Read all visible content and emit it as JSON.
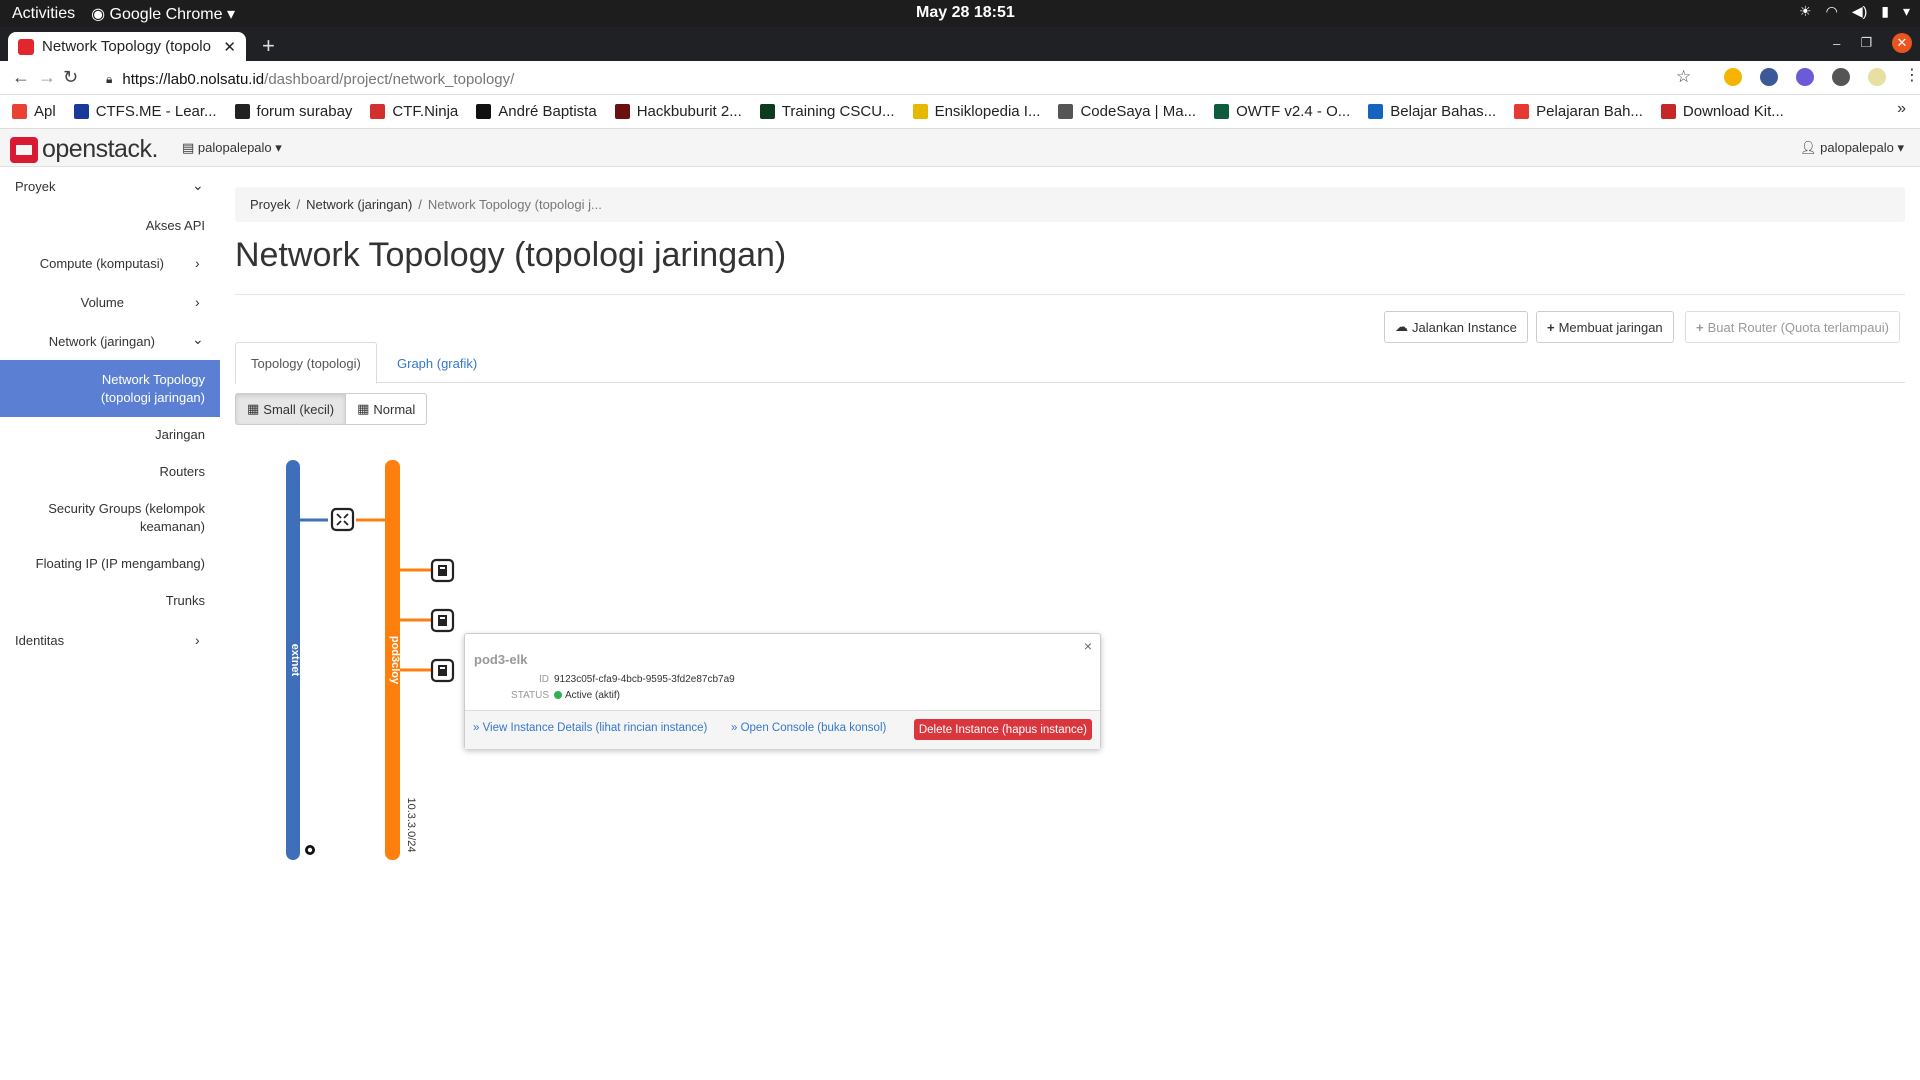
{
  "os": {
    "activities": "Activities",
    "app": "Google Chrome",
    "datetime": "May 28  18:51"
  },
  "browser": {
    "tab_title": "Network Topology (topolo",
    "url_host": "https://lab0.nolsatu.id",
    "url_path": "/dashboard/project/network_topology/",
    "bookmarks": [
      {
        "label": "Apl",
        "color": "#e94235"
      },
      {
        "label": "CTFS.ME - Lear...",
        "color": "#1a3a9a"
      },
      {
        "label": "forum surabay",
        "color": "#222222"
      },
      {
        "label": "CTF.Ninja",
        "color": "#d32f2f"
      },
      {
        "label": "André Baptista",
        "color": "#111111"
      },
      {
        "label": "Hackbuburit 2...",
        "color": "#6b0f0f"
      },
      {
        "label": "Training CSCU...",
        "color": "#0d3b1e"
      },
      {
        "label": "Ensiklopedia I...",
        "color": "#e6b800"
      },
      {
        "label": "CodeSaya | Ma...",
        "color": "#555555"
      },
      {
        "label": "OWTF v2.4 - O...",
        "color": "#0b5d3b"
      },
      {
        "label": "Belajar Bahas...",
        "color": "#1565c0"
      },
      {
        "label": "Pelajaran Bah...",
        "color": "#e53935"
      },
      {
        "label": "Download Kit...",
        "color": "#c62828"
      }
    ]
  },
  "header": {
    "logo": "openstack.",
    "project": "palopalepalo",
    "user": "palopalepalo"
  },
  "sidebar": {
    "items": [
      {
        "label": "Proyek"
      },
      {
        "label": "Akses API"
      },
      {
        "label": "Compute (komputasi)"
      },
      {
        "label": "Volume"
      },
      {
        "label": "Network (jaringan)"
      },
      {
        "label": "Network Topology (topologi jaringan)"
      },
      {
        "label": "Jaringan"
      },
      {
        "label": "Routers"
      },
      {
        "label": "Security Groups (kelompok keamanan)"
      },
      {
        "label": "Floating IP (IP mengambang)"
      },
      {
        "label": "Trunks"
      },
      {
        "label": "Identitas"
      }
    ]
  },
  "breadcrumb": {
    "items": [
      "Proyek",
      "Network (jaringan)",
      "Network Topology (topologi j..."
    ]
  },
  "page": {
    "title": "Network Topology (topologi jaringan)"
  },
  "actions": {
    "launch": "Jalankan Instance",
    "create_network": "Membuat jaringan",
    "create_router": "Buat Router (Quota terlampaui)"
  },
  "tabs": [
    "Topology (topologi)",
    "Graph (grafik)"
  ],
  "view_toggle": {
    "small": "Small (kecil)",
    "normal": "Normal"
  },
  "topology": {
    "networks": [
      {
        "name": "extnet",
        "color": "#3f6fb8",
        "cidr": ""
      },
      {
        "name": "pod3cloy",
        "color": "#ff7f0e",
        "cidr": "10.3.3.0/24"
      }
    ],
    "instance_count": 3
  },
  "popup": {
    "name": "pod3-elk",
    "id_label": "ID",
    "id": "9123c05f-cfa9-4bcb-9595-3fd2e87cb7a9",
    "status_label": "STATUS",
    "status": "Active (aktif)",
    "details_link": "» View Instance Details (lihat rincian instance)",
    "console_link": "» Open Console (buka konsol)",
    "delete": "Delete Instance (hapus instance)",
    "close": "×"
  },
  "colors": {
    "accent": "#5b80d3",
    "danger": "#d9363e",
    "link": "#3579c9",
    "active_status": "#2fb14f"
  }
}
